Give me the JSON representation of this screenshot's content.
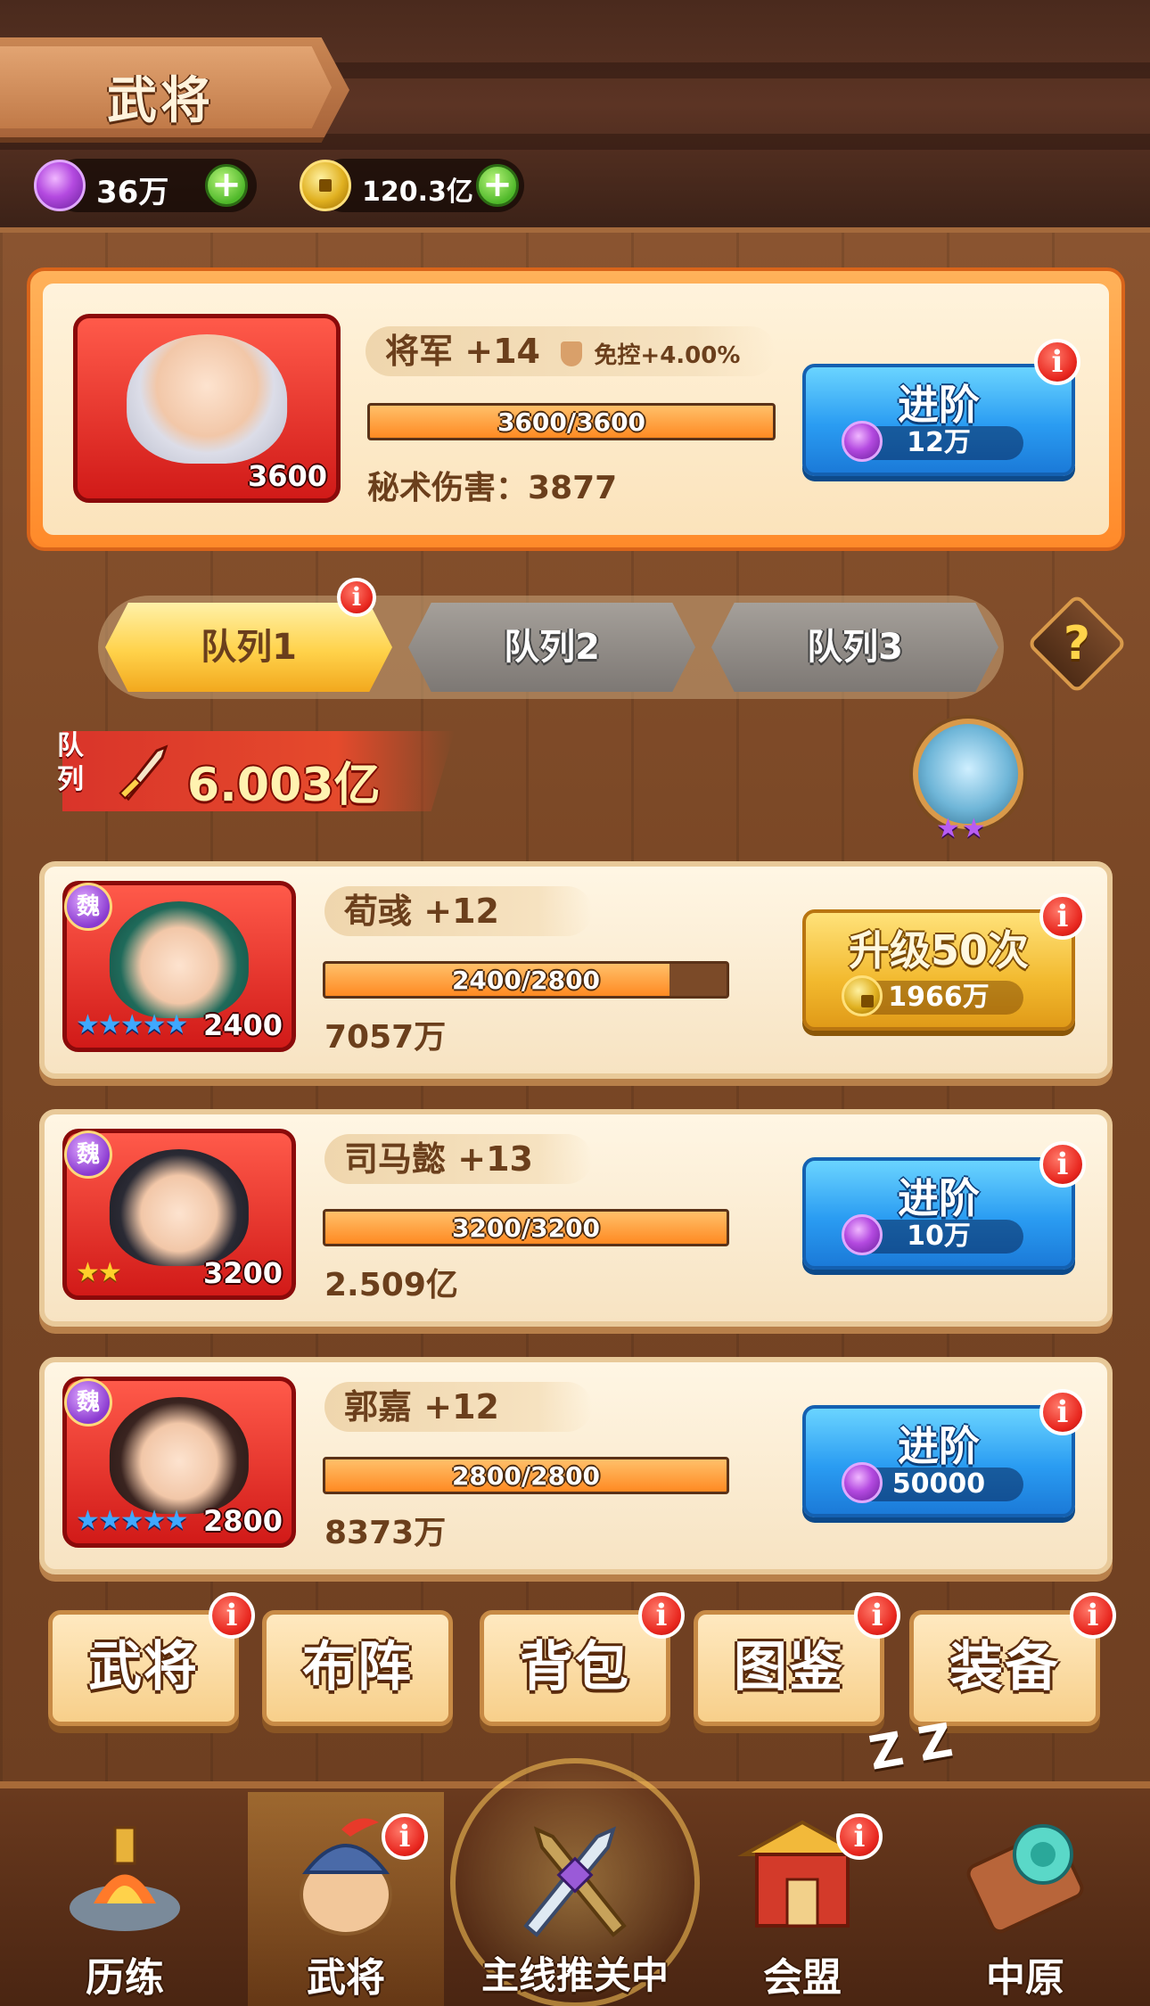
{
  "header": {
    "title": "武将",
    "currencies": [
      {
        "icon": "purple-gem-icon",
        "value": "36万"
      },
      {
        "icon": "gold-coin-icon",
        "value": "120.3亿"
      }
    ]
  },
  "general": {
    "level": "3600",
    "name": "将军 +14",
    "buff": "免控+4.00%",
    "progress_text": "3600/3600",
    "progress": 1.0,
    "stat_label": "秘术伤害：",
    "stat_value": "3877",
    "action": {
      "label": "进阶",
      "cost": "12万",
      "cost_icon": "purple-gem-icon"
    },
    "alert": "i"
  },
  "tabs": [
    {
      "label": "队列1",
      "active": true,
      "alert": "i"
    },
    {
      "label": "队列2",
      "active": false
    },
    {
      "label": "队列3",
      "active": false
    }
  ],
  "help": "?",
  "team_power": {
    "tag_line1": "队",
    "tag_line2": "列",
    "value": "6.003亿",
    "pet_stars": "★★"
  },
  "heroes": [
    {
      "faction": "魏",
      "name": "荀彧 +12",
      "level": "2400",
      "stars": "★★★★★",
      "star_color": "blue",
      "progress_text": "2400/2800",
      "progress": 0.857,
      "power": "7057万",
      "action": {
        "type": "gold",
        "label": "升级50次",
        "cost": "1966万",
        "cost_icon": "gold-coin-icon"
      },
      "alert": "i"
    },
    {
      "faction": "魏",
      "name": "司马懿 +13",
      "level": "3200",
      "stars": "★★",
      "star_color": "gold",
      "progress_text": "3200/3200",
      "progress": 1.0,
      "power": "2.509亿",
      "action": {
        "type": "blue",
        "label": "进阶",
        "cost": "10万",
        "cost_icon": "purple-gem-icon"
      },
      "alert": "i"
    },
    {
      "faction": "魏",
      "name": "郭嘉 +12",
      "level": "2800",
      "stars": "★★★★★",
      "star_color": "blue",
      "progress_text": "2800/2800",
      "progress": 1.0,
      "power": "8373万",
      "action": {
        "type": "blue",
        "label": "进阶",
        "cost": "50000",
        "cost_icon": "purple-gem-icon"
      },
      "alert": "i"
    }
  ],
  "menu": [
    {
      "label": "武将",
      "alert": "i"
    },
    {
      "label": "布阵",
      "alert": ""
    },
    {
      "label": "背包",
      "alert": "i"
    },
    {
      "label": "图鉴",
      "alert": "i"
    },
    {
      "label": "装备",
      "alert": "i"
    }
  ],
  "nav": [
    {
      "label": "历练",
      "icon": "training-icon"
    },
    {
      "label": "武将",
      "icon": "general-helmet-icon",
      "active": true,
      "alert": "i"
    },
    {
      "label": "主线推关中",
      "icon": "crossed-swords-icon"
    },
    {
      "label": "会盟",
      "icon": "alliance-gate-icon",
      "alert": "i"
    },
    {
      "label": "中原",
      "icon": "scroll-map-icon"
    }
  ],
  "idle_indicator": "Z Z"
}
